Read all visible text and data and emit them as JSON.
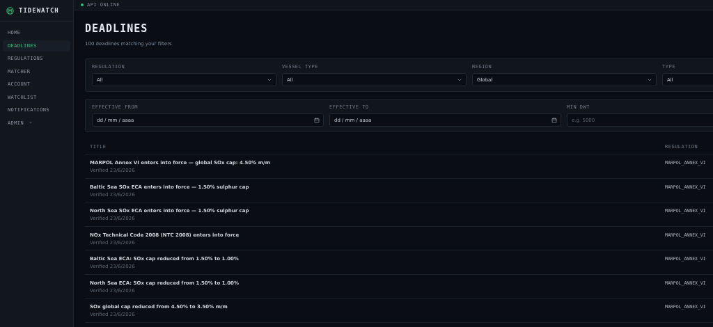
{
  "brand": {
    "name": "TIDEWATCH"
  },
  "nav": [
    {
      "label": "HOME",
      "selected": false
    },
    {
      "label": "DEADLINES",
      "selected": true
    },
    {
      "label": "REGULATIONS",
      "selected": false
    },
    {
      "label": "MATCHER",
      "selected": false
    },
    {
      "label": "ACCOUNT",
      "selected": false
    },
    {
      "label": "WATCHLIST",
      "selected": false
    },
    {
      "label": "NOTIFICATIONS",
      "selected": false
    },
    {
      "label": "ADMIN",
      "selected": false,
      "has_caret": true
    }
  ],
  "status": {
    "label": "API ONLINE",
    "online": true
  },
  "page": {
    "title": "DEADLINES",
    "subtitle": "100 deadlines matching your filters"
  },
  "filters": [
    {
      "label": "REGULATION",
      "kind": "select",
      "value": "All"
    },
    {
      "label": "VESSEL TYPE",
      "kind": "select",
      "value": "All"
    },
    {
      "label": "REGION",
      "kind": "select",
      "value": "Global"
    },
    {
      "label": "TYPE",
      "kind": "select",
      "value": "All"
    }
  ],
  "filters_2": [
    {
      "label": "EFFECTIVE FROM",
      "kind": "date",
      "value": "dd / mm / aaaa"
    },
    {
      "label": "EFFECTIVE TO",
      "kind": "date",
      "value": "dd / mm / aaaa"
    },
    {
      "label": "MIN DWT",
      "kind": "number",
      "placeholder": "e.g. 5000"
    }
  ],
  "table": {
    "columns": [
      "TITLE",
      "REGULATION"
    ],
    "rows": [
      {
        "title": "MARPOL Annex VI enters into force — global SOx cap: 4.50% m/m",
        "verified": "Verified 23/6/2026",
        "regulation": "MARPOL_ANNEX_VI"
      },
      {
        "title": "Baltic Sea SOx ECA enters into force — 1.50% sulphur cap",
        "verified": "Verified 23/6/2026",
        "regulation": "MARPOL_ANNEX_VI"
      },
      {
        "title": "North Sea SOx ECA enters into force — 1.50% sulphur cap",
        "verified": "Verified 23/6/2026",
        "regulation": "MARPOL_ANNEX_VI"
      },
      {
        "title": "NOx Technical Code 2008 (NTC 2008) enters into force",
        "verified": "Verified 23/6/2026",
        "regulation": "MARPOL_ANNEX_VI"
      },
      {
        "title": "Baltic Sea ECA: SOx cap reduced from 1.50% to 1.00%",
        "verified": "Verified 23/6/2026",
        "regulation": "MARPOL_ANNEX_VI"
      },
      {
        "title": "North Sea ECA: SOx cap reduced from 1.50% to 1.00%",
        "verified": "Verified 23/6/2026",
        "regulation": "MARPOL_ANNEX_VI"
      },
      {
        "title": "SOx global cap reduced from 4.50% to 3.50% m/m",
        "verified": "Verified 23/6/2026",
        "regulation": "MARPOL_ANNEX_VI"
      }
    ]
  }
}
